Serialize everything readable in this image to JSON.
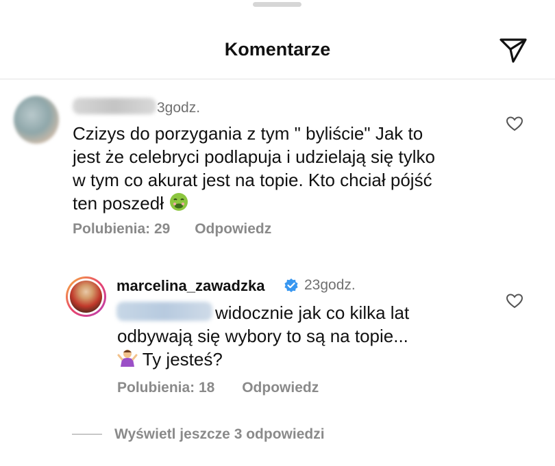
{
  "header": {
    "title": "Komentarze",
    "send_icon": "paper-plane-icon"
  },
  "comments": [
    {
      "time": "3godz.",
      "lines": [
        "Czizys do porzygania z tym \" byliście\" Jak to",
        "jest że celebryci podlapuja i udzielają się tylko",
        "w tym co akurat jest na topie. Kto chciał pójść",
        "ten poszedł"
      ],
      "emoji": "nauseated-face-emoji",
      "likes_label": "Polubienia: 29",
      "reply_label": "Odpowiedz"
    }
  ],
  "reply": {
    "username": "marcelina_zawadzka",
    "verified_icon": "verified-badge-icon",
    "time": "23godz.",
    "lines": [
      "widocznie jak co kilka lat",
      "odbywają się wybory  to są na topie...",
      "Ty jesteś?"
    ],
    "emoji": "person-shrugging-emoji",
    "likes_label": "Polubienia: 18",
    "reply_label": "Odpowiedz"
  },
  "view_more": "Wyświetl jeszcze 3 odpowiedzi",
  "colors": {
    "text": "#111111",
    "muted": "#8a8a8a",
    "verified": "#3897f0"
  }
}
